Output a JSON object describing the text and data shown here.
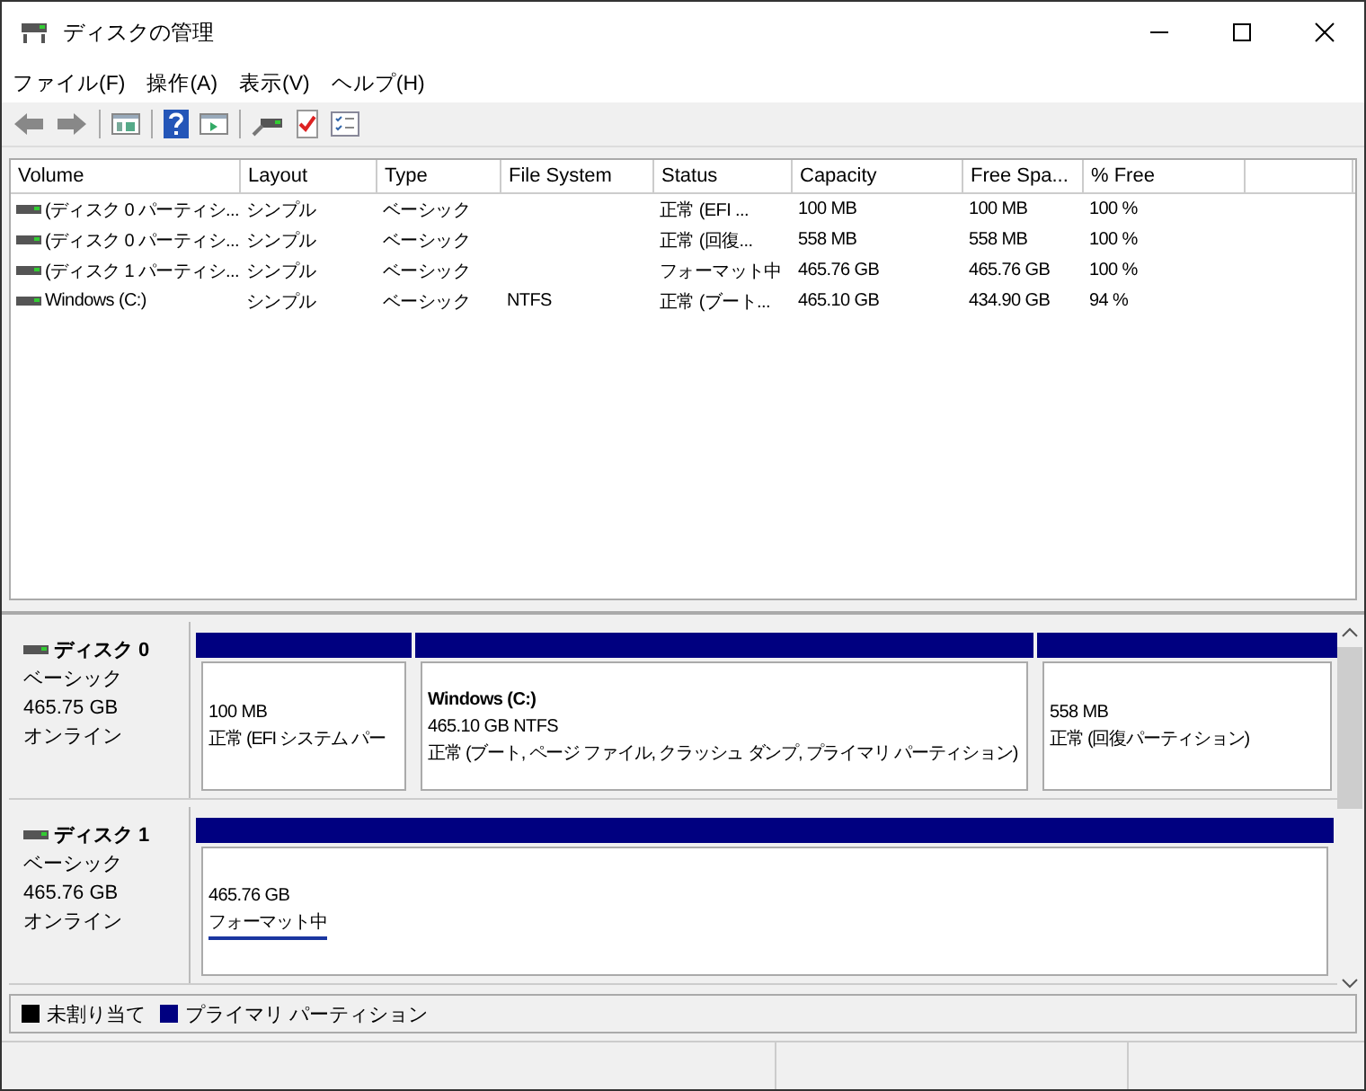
{
  "window": {
    "title": "ディスクの管理"
  },
  "menu": [
    "ファイル(F)",
    "操作(A)",
    "表示(V)",
    "ヘルプ(H)"
  ],
  "toolbar": [
    {
      "kind": "back",
      "disabled": false
    },
    {
      "kind": "forward",
      "disabled": false
    },
    {
      "kind": "sep"
    },
    {
      "kind": "panel"
    },
    {
      "kind": "sep"
    },
    {
      "kind": "help"
    },
    {
      "kind": "panel2"
    },
    {
      "kind": "sep"
    },
    {
      "kind": "connect"
    },
    {
      "kind": "check"
    },
    {
      "kind": "list"
    }
  ],
  "table": {
    "columns": [
      "Volume",
      "Layout",
      "Type",
      "File System",
      "Status",
      "Capacity",
      "Free Spa...",
      "% Free"
    ],
    "rows": [
      [
        "(ディスク 0 パーティシ...",
        "シンプル",
        "ベーシック",
        "",
        "正常 (EFI ...",
        "100 MB",
        "100 MB",
        "100 %"
      ],
      [
        "(ディスク 0 パーティシ...",
        "シンプル",
        "ベーシック",
        "",
        "正常 (回復...",
        "558 MB",
        "558 MB",
        "100 %"
      ],
      [
        "(ディスク 1 パーティシ...",
        "シンプル",
        "ベーシック",
        "",
        "フォーマット中",
        "465.76 GB",
        "465.76 GB",
        "100 %"
      ],
      [
        "Windows (C:)",
        "シンプル",
        "ベーシック",
        "NTFS",
        "正常 (ブート...",
        "465.10 GB",
        "434.90 GB",
        "94 %"
      ]
    ]
  },
  "disks": [
    {
      "name": "ディスク 0",
      "type": "ベーシック",
      "size": "465.75 GB",
      "state": "オンライン",
      "partitions": [
        {
          "color": "#000080",
          "size": "100 MB",
          "status": "正常 (EFI システム パー",
          "focused": false
        },
        {
          "color": "#000080",
          "name": "Windows  (C:)",
          "size": "465.10 GB NTFS",
          "status": "正常 (ブート, ページ ファイル, クラッシュ ダンプ, プライマリ パーティション)",
          "focused": false
        },
        {
          "color": "#000080",
          "size": "558 MB",
          "status": "正常 (回復パーティション)",
          "focused": false
        }
      ]
    },
    {
      "name": "ディスク 1",
      "type": "ベーシック",
      "size": "465.76 GB",
      "state": "オンライン",
      "partitions": [
        {
          "color": "#000080",
          "size": "465.76 GB",
          "status": "フォーマット中",
          "focused": true
        }
      ]
    }
  ],
  "legend": [
    {
      "color": "#000000",
      "label": "未割り当て"
    },
    {
      "color": "#000080",
      "label": "プライマリ パーティション"
    }
  ]
}
